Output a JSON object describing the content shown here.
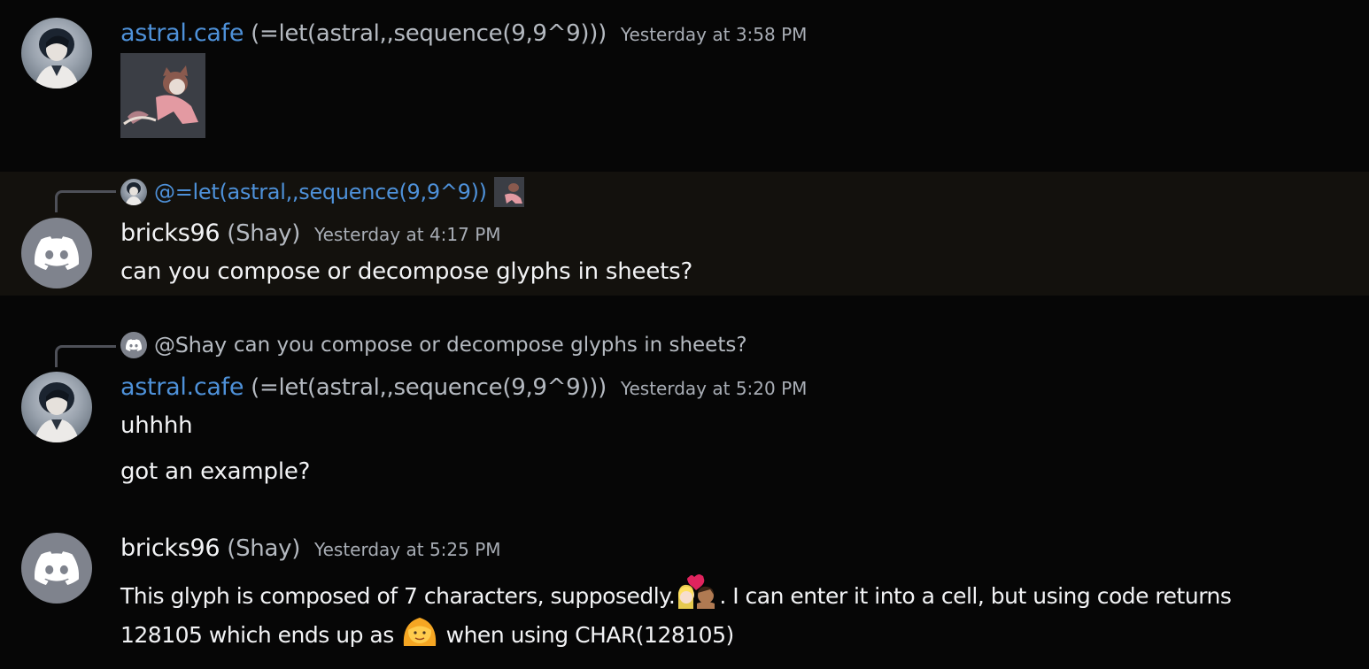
{
  "messages": [
    {
      "username": "astral.cafe",
      "nickname": "(=let(astral,,sequence(9,9^9)))",
      "timestamp": "Yesterday at 3:58 PM",
      "attachment_icon": "pink-cat-sticker-image"
    },
    {
      "reply": {
        "mention": "@=let(astral,,sequence(9,9^9))",
        "thumb_icon": "pink-cat-sticker-image"
      },
      "username": "bricks96",
      "nickname": "(Shay)",
      "timestamp": "Yesterday at 4:17 PM",
      "text": "can you compose or decompose glyphs in sheets?"
    },
    {
      "reply": {
        "mention": "@Shay",
        "text": "can you compose or decompose glyphs in sheets?"
      },
      "username": "astral.cafe",
      "nickname": "(=let(astral,,sequence(9,9^9)))",
      "timestamp": "Yesterday at 5:20 PM",
      "lines": [
        "uhhhh",
        "got an example?"
      ]
    },
    {
      "username": "bricks96",
      "nickname": "(Shay)",
      "timestamp": "Yesterday at 5:25 PM",
      "line1_a": "This glyph is composed of 7 characters, supposedly.",
      "line1_b": ". I can enter it into a cell, but using code returns",
      "line2_a": "128105 which ends up as",
      "line2_b": "when using CHAR(128105)",
      "emoji_icons": [
        "couple-with-heart-emoji",
        "woman-emoji"
      ]
    }
  ],
  "colors": {
    "background": "#060606",
    "username_link": "#4e91d9",
    "highlight": "#13110d",
    "muted": "#b5bac1"
  }
}
